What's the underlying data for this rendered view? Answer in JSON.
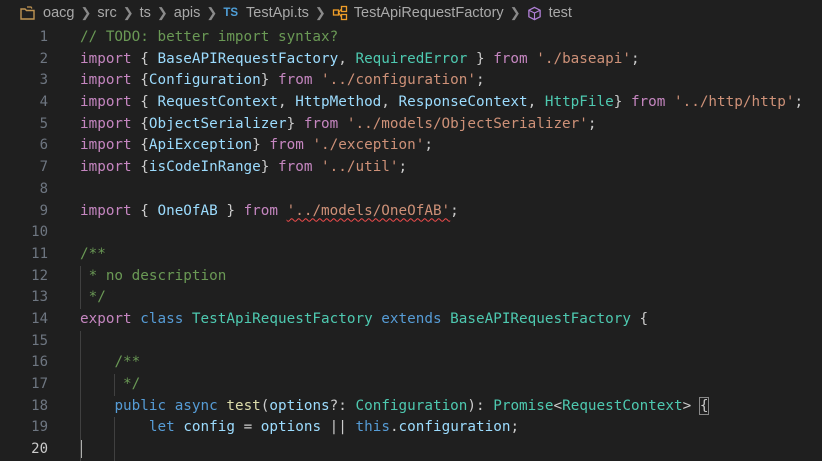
{
  "breadcrumb": {
    "items": [
      "oacg",
      "src",
      "ts",
      "apis",
      "TestApi.ts",
      "TestApiRequestFactory",
      "test"
    ],
    "file_badge": "TS"
  },
  "lines": [
    {
      "n": "1",
      "tokens": [
        [
          "c",
          "// TODO: better import syntax?"
        ]
      ]
    },
    {
      "n": "2",
      "tokens": [
        [
          "k",
          "import"
        ],
        [
          "p",
          " { "
        ],
        [
          "v",
          "BaseAPIRequestFactory"
        ],
        [
          "p",
          ", "
        ],
        [
          "t",
          "RequiredError"
        ],
        [
          "p",
          " } "
        ],
        [
          "k",
          "from"
        ],
        [
          "p",
          " "
        ],
        [
          "s",
          "'./baseapi'"
        ],
        [
          "p",
          ";"
        ]
      ]
    },
    {
      "n": "3",
      "tokens": [
        [
          "k",
          "import"
        ],
        [
          "p",
          " {"
        ],
        [
          "v",
          "Configuration"
        ],
        [
          "p",
          "} "
        ],
        [
          "k",
          "from"
        ],
        [
          "p",
          " "
        ],
        [
          "s",
          "'../configuration'"
        ],
        [
          "p",
          ";"
        ]
      ]
    },
    {
      "n": "4",
      "tokens": [
        [
          "k",
          "import"
        ],
        [
          "p",
          " { "
        ],
        [
          "v",
          "RequestContext"
        ],
        [
          "p",
          ", "
        ],
        [
          "v",
          "HttpMethod"
        ],
        [
          "p",
          ", "
        ],
        [
          "v",
          "ResponseContext"
        ],
        [
          "p",
          ", "
        ],
        [
          "t",
          "HttpFile"
        ],
        [
          "p",
          "} "
        ],
        [
          "k",
          "from"
        ],
        [
          "p",
          " "
        ],
        [
          "s",
          "'../http/http'"
        ],
        [
          "p",
          ";"
        ]
      ]
    },
    {
      "n": "5",
      "tokens": [
        [
          "k",
          "import"
        ],
        [
          "p",
          " {"
        ],
        [
          "v",
          "ObjectSerializer"
        ],
        [
          "p",
          "} "
        ],
        [
          "k",
          "from"
        ],
        [
          "p",
          " "
        ],
        [
          "s",
          "'../models/ObjectSerializer'"
        ],
        [
          "p",
          ";"
        ]
      ]
    },
    {
      "n": "6",
      "tokens": [
        [
          "k",
          "import"
        ],
        [
          "p",
          " {"
        ],
        [
          "v",
          "ApiException"
        ],
        [
          "p",
          "} "
        ],
        [
          "k",
          "from"
        ],
        [
          "p",
          " "
        ],
        [
          "s",
          "'./exception'"
        ],
        [
          "p",
          ";"
        ]
      ]
    },
    {
      "n": "7",
      "tokens": [
        [
          "k",
          "import"
        ],
        [
          "p",
          " {"
        ],
        [
          "v",
          "isCodeInRange"
        ],
        [
          "p",
          "} "
        ],
        [
          "k",
          "from"
        ],
        [
          "p",
          " "
        ],
        [
          "s",
          "'../util'"
        ],
        [
          "p",
          ";"
        ]
      ]
    },
    {
      "n": "8",
      "tokens": []
    },
    {
      "n": "9",
      "tokens": [
        [
          "k",
          "import"
        ],
        [
          "p",
          " { "
        ],
        [
          "v",
          "OneOfAB"
        ],
        [
          "p",
          " } "
        ],
        [
          "k",
          "from"
        ],
        [
          "p",
          " "
        ],
        [
          "s squiggle",
          "'../models/OneOfAB'"
        ],
        [
          "p",
          ";"
        ]
      ]
    },
    {
      "n": "10",
      "tokens": []
    },
    {
      "n": "11",
      "tokens": [
        [
          "c",
          "/**"
        ]
      ]
    },
    {
      "n": "12",
      "tokens": [
        [
          "c",
          " * no description"
        ]
      ]
    },
    {
      "n": "13",
      "tokens": [
        [
          "c",
          " */"
        ]
      ]
    },
    {
      "n": "14",
      "tokens": [
        [
          "k",
          "export"
        ],
        [
          "p",
          " "
        ],
        [
          "kb",
          "class"
        ],
        [
          "p",
          " "
        ],
        [
          "t",
          "TestApiRequestFactory"
        ],
        [
          "p",
          " "
        ],
        [
          "kb",
          "extends"
        ],
        [
          "p",
          " "
        ],
        [
          "t",
          "BaseAPIRequestFactory"
        ],
        [
          "p",
          " {"
        ]
      ]
    },
    {
      "n": "15",
      "tokens": []
    },
    {
      "n": "16",
      "tokens": [
        [
          "p",
          "    "
        ],
        [
          "c",
          "/**"
        ]
      ]
    },
    {
      "n": "17",
      "tokens": [
        [
          "p",
          "    "
        ],
        [
          "c",
          " */"
        ]
      ]
    },
    {
      "n": "18",
      "tokens": [
        [
          "p",
          "    "
        ],
        [
          "kb",
          "public"
        ],
        [
          "p",
          " "
        ],
        [
          "kb",
          "async"
        ],
        [
          "p",
          " "
        ],
        [
          "f",
          "test"
        ],
        [
          "p",
          "("
        ],
        [
          "v",
          "options"
        ],
        [
          "p",
          "?: "
        ],
        [
          "t",
          "Configuration"
        ],
        [
          "p",
          "): "
        ],
        [
          "t",
          "Promise"
        ],
        [
          "p",
          "<"
        ],
        [
          "t",
          "RequestContext"
        ],
        [
          "p",
          "> "
        ],
        [
          "p bracket-box",
          "{"
        ]
      ]
    },
    {
      "n": "19",
      "tokens": [
        [
          "p",
          "        "
        ],
        [
          "kb",
          "let"
        ],
        [
          "p",
          " "
        ],
        [
          "v",
          "config"
        ],
        [
          "p",
          " = "
        ],
        [
          "v",
          "options"
        ],
        [
          "p",
          " || "
        ],
        [
          "kb",
          "this"
        ],
        [
          "p",
          "."
        ],
        [
          "v",
          "configuration"
        ],
        [
          "p",
          ";"
        ]
      ]
    },
    {
      "n": "20",
      "tokens": [],
      "current": true
    }
  ]
}
